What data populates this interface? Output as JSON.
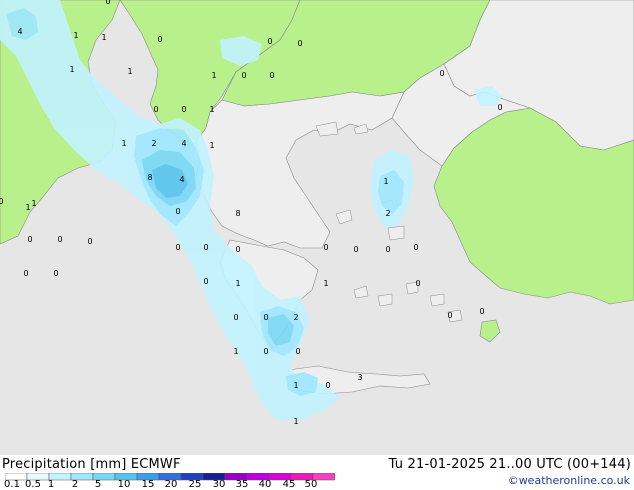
{
  "title": {
    "variable": "Precipitation [mm]",
    "model": "ECMWF"
  },
  "valid_time": "Tu 21-01-2025 21..00 UTC (00+144)",
  "credit": "©weatheronline.co.uk",
  "legend": {
    "labels": [
      "0.1",
      "0.5",
      "1",
      "2",
      "5",
      "10",
      "15",
      "20",
      "25",
      "30",
      "35",
      "40",
      "45",
      "50"
    ],
    "colors": [
      "#ffffff",
      "#e6fbff",
      "#c2f3ff",
      "#9ee8ff",
      "#78d8f6",
      "#55c3ee",
      "#3a9fe8",
      "#2f6fe0",
      "#2040c0",
      "#181f8e",
      "#9a00c8",
      "#c000e0",
      "#de00d8",
      "#ee18b8",
      "#f640c0"
    ]
  },
  "map_colors": {
    "sea": "#e6e6e6",
    "land": "#b8f08c",
    "land_dry": "#eeeeee",
    "coast": "#8a8a8a"
  },
  "values": [
    {
      "v": "4"
    },
    {
      "v": "1"
    },
    {
      "v": "1"
    },
    {
      "v": "0"
    },
    {
      "v": "0"
    },
    {
      "v": "0"
    },
    {
      "v": "1"
    },
    {
      "v": "1"
    },
    {
      "v": "1"
    },
    {
      "v": "0"
    },
    {
      "v": "0"
    },
    {
      "v": "0"
    },
    {
      "v": "0"
    },
    {
      "v": "0"
    },
    {
      "v": "1"
    },
    {
      "v": "1"
    },
    {
      "v": "2"
    },
    {
      "v": "4"
    },
    {
      "v": "1"
    },
    {
      "v": "8"
    },
    {
      "v": "4"
    },
    {
      "v": "0"
    },
    {
      "v": "1"
    },
    {
      "v": "8"
    },
    {
      "v": "0"
    },
    {
      "v": "0"
    },
    {
      "v": "0"
    },
    {
      "v": "0"
    },
    {
      "v": "0"
    },
    {
      "v": "0"
    },
    {
      "v": "1"
    },
    {
      "v": "2"
    },
    {
      "v": "0"
    },
    {
      "v": "0"
    },
    {
      "v": "0"
    },
    {
      "v": "0"
    },
    {
      "v": "0"
    },
    {
      "v": "0"
    },
    {
      "v": "0"
    },
    {
      "v": "1"
    },
    {
      "v": "1"
    },
    {
      "v": "0"
    },
    {
      "v": "0"
    },
    {
      "v": "0"
    },
    {
      "v": "0"
    },
    {
      "v": "0"
    },
    {
      "v": "0"
    },
    {
      "v": "2"
    },
    {
      "v": "1"
    },
    {
      "v": "0"
    },
    {
      "v": "0"
    },
    {
      "v": "1"
    },
    {
      "v": "0"
    },
    {
      "v": "3"
    },
    {
      "v": "1"
    },
    {
      "v": "0"
    },
    {
      "v": "1"
    },
    {
      "v": "0"
    }
  ]
}
